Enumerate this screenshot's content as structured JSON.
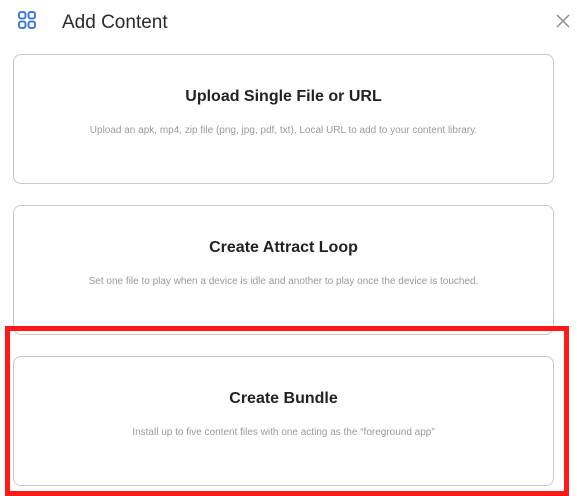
{
  "header": {
    "title": "Add Content",
    "icon": "grid-icon",
    "icon_color": "#2f6fd6",
    "close_icon": "close-icon"
  },
  "options": [
    {
      "title": "Upload Single File or URL",
      "description": "Upload an apk, mp4, zip file (png, jpg, pdf, txt), Local URL to add to your content library."
    },
    {
      "title": "Create Attract Loop",
      "description": "Set one file to play when a device is idle and another to play once the device is touched."
    },
    {
      "title": "Create Bundle",
      "description": "Install up to five content files with one acting as the “foreground app”"
    }
  ],
  "highlight_color": "#ff1a1a"
}
